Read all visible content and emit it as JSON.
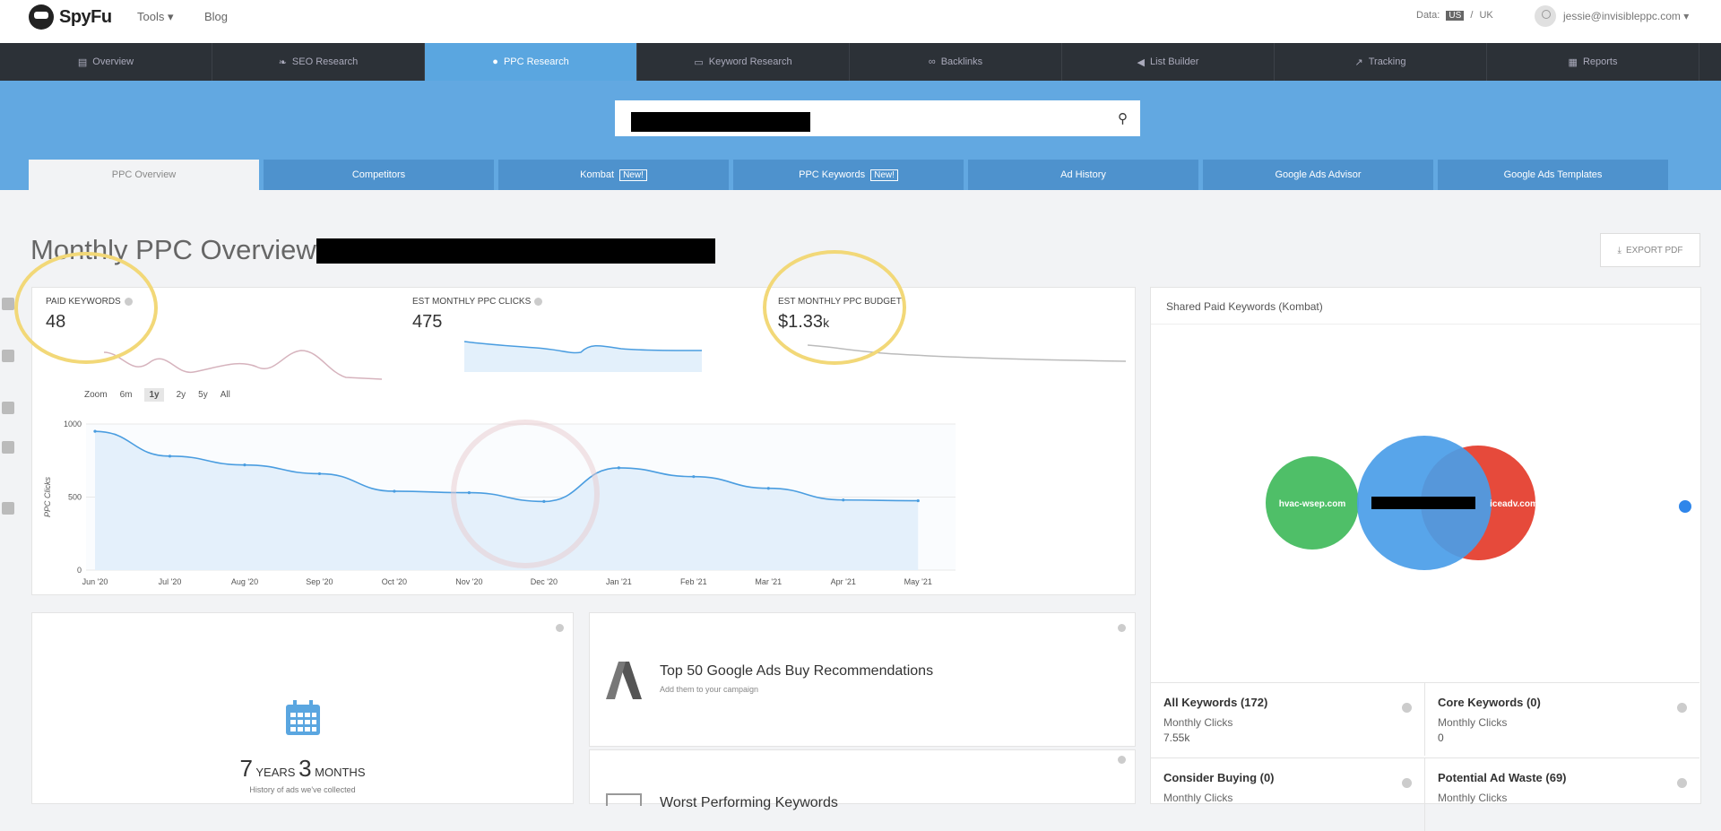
{
  "topbar": {
    "brand": "SpyFu",
    "tools_label": "Tools ▾",
    "blog_label": "Blog",
    "data_label": "Data:",
    "data_us": "US",
    "data_sep": "/",
    "data_uk": "UK",
    "user_email": "jessie@invisibleppc.com ▾"
  },
  "main_nav": [
    {
      "label": "Overview",
      "icon": "chart-icon"
    },
    {
      "label": "SEO Research",
      "icon": "leaf-icon"
    },
    {
      "label": "PPC Research",
      "icon": "circle-icon",
      "active": true
    },
    {
      "label": "Keyword Research",
      "icon": "keyboard-icon"
    },
    {
      "label": "Backlinks",
      "icon": "link-icon"
    },
    {
      "label": "List Builder",
      "icon": "megaphone-icon"
    },
    {
      "label": "Tracking",
      "icon": "trend-icon"
    },
    {
      "label": "Reports",
      "icon": "document-icon"
    }
  ],
  "sub_tabs": [
    {
      "label": "PPC Overview",
      "active": true
    },
    {
      "label": "Competitors"
    },
    {
      "label": "Kombat",
      "badge": "New!"
    },
    {
      "label": "PPC Keywords",
      "badge": "New!"
    },
    {
      "label": "Ad History"
    },
    {
      "label": "Google Ads Advisor"
    },
    {
      "label": "Google Ads Templates"
    }
  ],
  "page": {
    "title": "Monthly PPC Overview",
    "export_label": "EXPORT PDF"
  },
  "stats": {
    "paid_keywords": {
      "label": "PAID KEYWORDS",
      "value": "48"
    },
    "clicks": {
      "label": "EST MONTHLY PPC CLICKS",
      "value": "475"
    },
    "budget": {
      "label": "EST MONTHLY PPC BUDGET",
      "value": "$1.33",
      "unit": "k"
    }
  },
  "zoom": {
    "label": "Zoom",
    "options": [
      "6m",
      "1y",
      "2y",
      "5y",
      "All"
    ],
    "active": "1y"
  },
  "chart_data": {
    "type": "area",
    "xlabel": "",
    "ylabel": "PPC Clicks",
    "ylim": [
      0,
      1000
    ],
    "y_ticks": [
      "1000",
      "500",
      "0"
    ],
    "x": [
      "Jun '20",
      "Jul '20",
      "Aug '20",
      "Sep '20",
      "Oct '20",
      "Nov '20",
      "Dec '20",
      "Jan '21",
      "Feb '21",
      "Mar '21",
      "Apr '21",
      "May '21"
    ],
    "series": [
      {
        "values": [
          950,
          780,
          720,
          660,
          540,
          530,
          470,
          700,
          640,
          560,
          480,
          475
        ]
      }
    ]
  },
  "kombat": {
    "title": "Shared Paid Keywords (Kombat)",
    "circles": [
      {
        "label": "hvac-wsep.com",
        "color": "#4fbf68"
      },
      {
        "label": "",
        "color": "#4a9de8"
      },
      {
        "label": "iceadv.com",
        "color": "#e64a3b"
      }
    ],
    "boxes": [
      {
        "title": "All Keywords (172)",
        "label": "Monthly Clicks",
        "value": "7.55k"
      },
      {
        "title": "Core Keywords (0)",
        "label": "Monthly Clicks",
        "value": "0"
      },
      {
        "title": "Consider Buying (0)",
        "label": "Monthly Clicks",
        "value": ""
      },
      {
        "title": "Potential Ad Waste (69)",
        "label": "Monthly Clicks",
        "value": ""
      }
    ]
  },
  "history": {
    "years": "7",
    "years_unit": "YEARS",
    "months": "3",
    "months_unit": "MONTHS",
    "subtitle": "History of ads we've collected"
  },
  "recommendations": {
    "title": "Top 50 Google Ads Buy Recommendations",
    "subtitle": "Add them to your campaign"
  },
  "worst": {
    "title": "Worst Performing Keywords"
  }
}
